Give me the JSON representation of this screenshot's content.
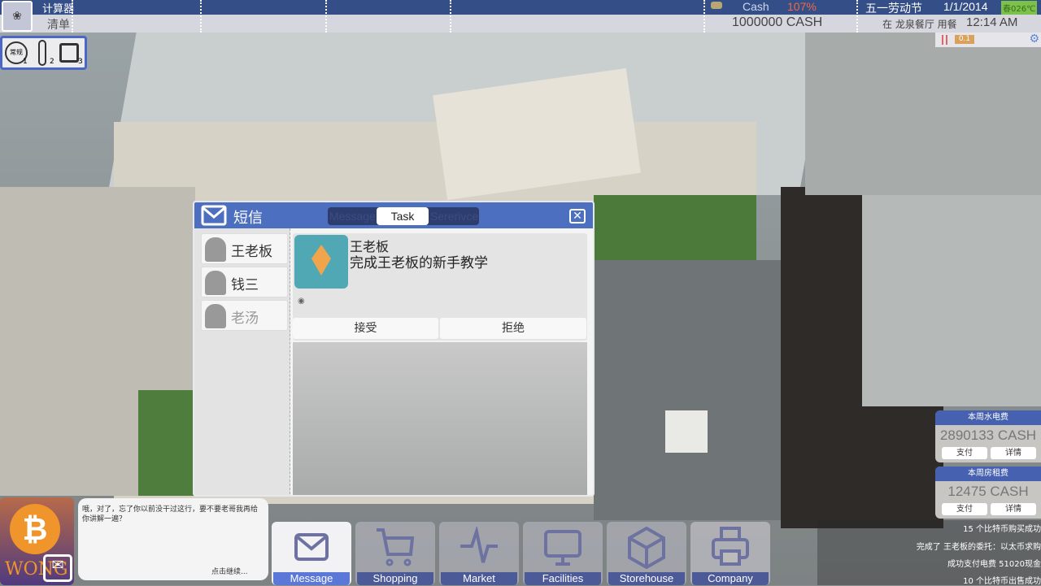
{
  "topbar": {
    "menu1": "计算器",
    "menu2": "清单",
    "cash_label": "Cash",
    "cash_percent": "107%",
    "cash_amount": "1000000 CASH",
    "holiday": "五一劳动节",
    "date": "1/1/2014",
    "weather": "春026℃",
    "status": "在 龙泉餐厅 用餐",
    "time": "12:14 AM",
    "speed": "0.1"
  },
  "modes": [
    {
      "label": "常规",
      "num": "1",
      "icon": "clock-icon"
    },
    {
      "label": "温度",
      "num": "2",
      "icon": "thermometer-icon"
    },
    {
      "label": "",
      "num": "3",
      "icon": "chip-icon"
    }
  ],
  "message_panel": {
    "title": "短信",
    "tabs": [
      "Message",
      "Task",
      "Sererivce"
    ],
    "active_tab": "Task",
    "contacts": [
      "王老板",
      "钱三",
      "老汤"
    ],
    "task": {
      "sender": "王老板",
      "description": "完成王老板的新手教学",
      "accept": "接受",
      "reject": "拒绝"
    }
  },
  "dialog": {
    "logo_text": "WONG",
    "text": "哦，对了，忘了你以前没干过这行，要不要老哥我再给你讲解一遍？",
    "continue": "点击继续..."
  },
  "dock": [
    {
      "label": "Message",
      "icon": "envelope-icon",
      "active": true
    },
    {
      "label": "Shopping",
      "icon": "cart-icon"
    },
    {
      "label": "Market",
      "icon": "pulse-icon"
    },
    {
      "label": "Facilities",
      "icon": "monitor-icon"
    },
    {
      "label": "Storehouse",
      "icon": "box-icon"
    },
    {
      "label": "Company",
      "icon": "printer-icon"
    }
  ],
  "bills": [
    {
      "title": "本周水电费",
      "amount": "2890133 CASH",
      "pay": "支付",
      "details": "详情"
    },
    {
      "title": "本周房租费",
      "amount": "12475 CASH",
      "pay": "支付",
      "details": "详情"
    }
  ],
  "log": [
    "15 个比特币购买成功",
    "完成了 王老板的委托：以太币求购",
    "成功支付电费 51020现金",
    "10 个比特币出售成功"
  ],
  "colors": {
    "accent": "#4d6fbf",
    "topbar": "#344f88",
    "cash_percent": "#f06a45",
    "weather": "#7cc24a"
  }
}
